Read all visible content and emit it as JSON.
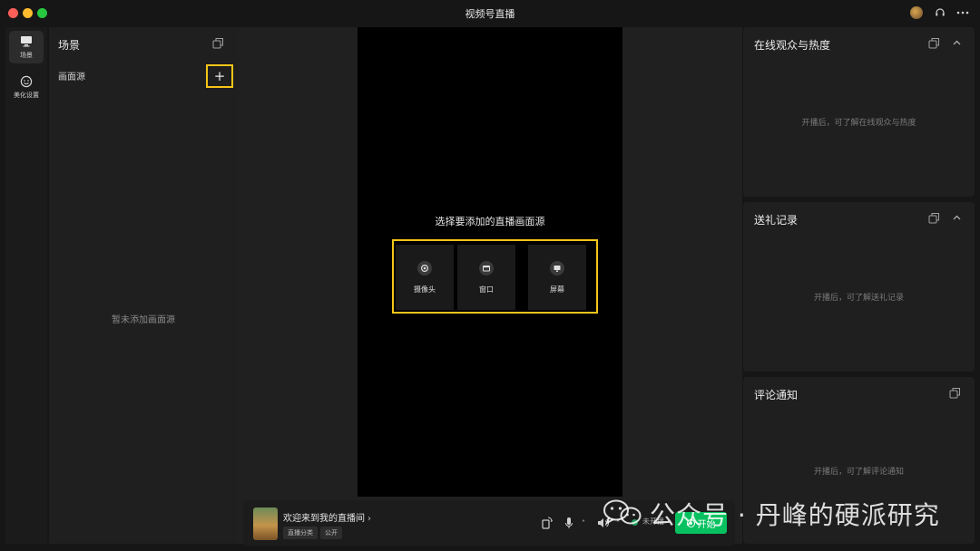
{
  "window": {
    "title": "视频号直播"
  },
  "nav": {
    "items": [
      {
        "label": "场景"
      },
      {
        "label": "美化设置"
      }
    ]
  },
  "scene_panel": {
    "title": "场景",
    "source_label": "画面源",
    "add_symbol": "+",
    "empty_text": "暂未添加画面源"
  },
  "preview": {
    "choose_title": "选择要添加的直播画面源",
    "options": [
      {
        "label": "摄像头"
      },
      {
        "label": "窗口"
      },
      {
        "label": "屏幕"
      }
    ]
  },
  "bottom_bar": {
    "room_title": "欢迎来到我的直播间",
    "room_chevron": "›",
    "tags": [
      "直播分类",
      "公开"
    ],
    "status": "未开播",
    "start_label": "开始",
    "arrow_symbol": "˄"
  },
  "right_panels": [
    {
      "title": "在线观众与热度",
      "empty": "开播后，可了解在线观众与热度"
    },
    {
      "title": "送礼记录",
      "empty": "开播后，可了解送礼记录"
    },
    {
      "title": "评论通知",
      "empty": "开播后，可了解评论通知"
    }
  ],
  "watermark": {
    "text": "公众号 · 丹峰的硬派研究"
  },
  "icons": {
    "titlebar": [
      "avatar-icon",
      "headset-icon",
      "more-icon"
    ],
    "accent_color": "#07c160",
    "highlight_color": "#f5c518"
  }
}
